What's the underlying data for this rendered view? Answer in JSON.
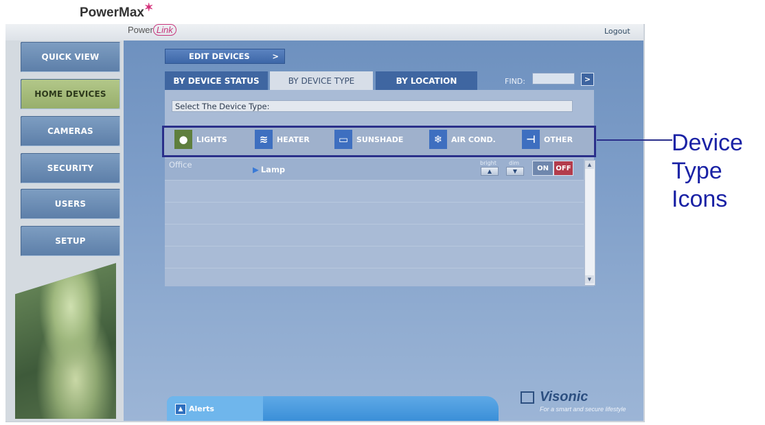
{
  "brand": {
    "name": "PowerMax",
    "sub_left": "Power",
    "sub_right": "Link"
  },
  "header": {
    "logout": "Logout"
  },
  "sidebar": {
    "items": [
      {
        "label": "QUICK VIEW"
      },
      {
        "label": "HOME DEVICES",
        "active": true
      },
      {
        "label": "CAMERAS"
      },
      {
        "label": "SECURITY"
      },
      {
        "label": "USERS"
      },
      {
        "label": "SETUP"
      }
    ]
  },
  "main": {
    "edit_devices": "EDIT DEVICES",
    "edit_arrow": ">",
    "tabs": [
      {
        "label": "BY DEVICE STATUS"
      },
      {
        "label": "BY DEVICE TYPE",
        "selected": true
      },
      {
        "label": "BY LOCATION"
      }
    ],
    "find_label": "FIND:",
    "find_value": "",
    "find_go": ">",
    "select_prompt": "Select The Device Type:",
    "types": [
      {
        "label": "LIGHTS",
        "icon": "lightbulb-icon",
        "color": "#5f7f3e"
      },
      {
        "label": "HEATER",
        "icon": "heat-waves-icon",
        "color": "#3e6fc0"
      },
      {
        "label": "SUNSHADE",
        "icon": "window-shade-icon",
        "color": "#3e6fc0"
      },
      {
        "label": "AIR COND.",
        "icon": "snowflake-icon",
        "color": "#3e6fc0"
      },
      {
        "label": "OTHER",
        "icon": "plug-icon",
        "color": "#3e6fc0"
      }
    ],
    "rows": [
      {
        "location": "Office",
        "device": "Lamp",
        "bright": "bright",
        "dim": "dim",
        "on": "ON",
        "off": "OFF"
      }
    ]
  },
  "alerts": {
    "label": "Alerts"
  },
  "footer": {
    "brand": "Visonic",
    "tagline": "For a smart and secure lifestyle"
  },
  "callout": {
    "line1": "Device",
    "line2": "Type",
    "line3": "Icons"
  },
  "colors": {
    "accent": "#2a2f8a",
    "panel": "#7d9dc8",
    "active_nav": "#a6bb7a",
    "off": "#b33c4c"
  }
}
